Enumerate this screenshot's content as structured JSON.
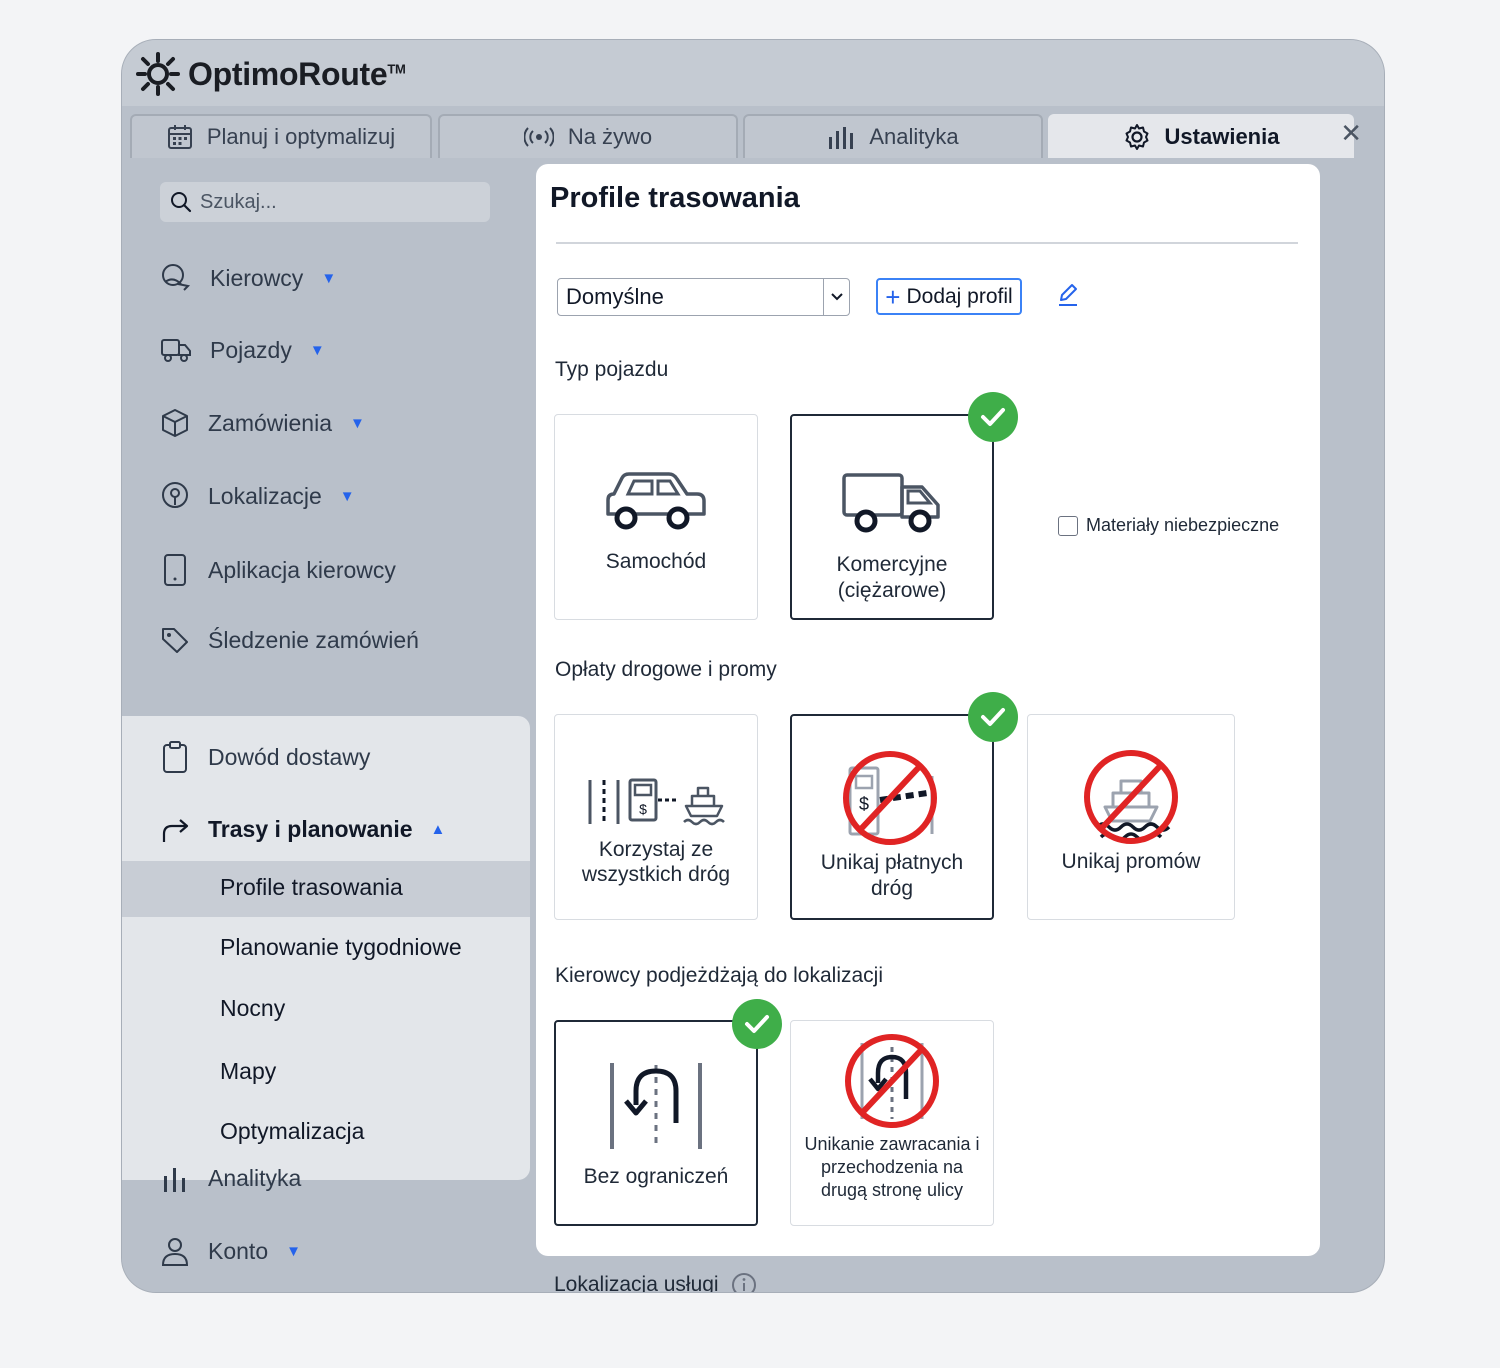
{
  "app": {
    "logo_text": "OptimoRoute",
    "logo_tm": "TM"
  },
  "tabs": [
    {
      "label": "Planuj i optymalizuj",
      "icon": "calendar-icon"
    },
    {
      "label": "Na żywo",
      "icon": "broadcast-icon"
    },
    {
      "label": "Analityka",
      "icon": "bar-chart-icon"
    },
    {
      "label": "Ustawienia",
      "icon": "gear-icon",
      "active": true
    }
  ],
  "sidebar": {
    "search_placeholder": "Szukaj...",
    "items": [
      {
        "label": "Kierowcy",
        "icon": "drivers-icon",
        "expandable": true
      },
      {
        "label": "Pojazdy",
        "icon": "truck-icon",
        "expandable": true
      },
      {
        "label": "Zamówienia",
        "icon": "box-icon",
        "expandable": true
      },
      {
        "label": "Lokalizacje",
        "icon": "location-pin-icon",
        "expandable": true
      },
      {
        "label": "Aplikacja kierowcy",
        "icon": "phone-icon"
      },
      {
        "label": "Śledzenie zamówień",
        "icon": "tag-icon"
      }
    ],
    "proof": {
      "label": "Dowód dostawy",
      "icon": "clipboard-icon"
    },
    "routes": {
      "label": "Trasy i planowanie",
      "icon": "route-arrow-icon"
    },
    "sub_items": [
      "Profile trasowania",
      "Planowanie tygodniowe",
      "Nocny",
      "Mapy",
      "Optymalizacja"
    ],
    "active_sub": "Profile trasowania",
    "analytics": {
      "label": "Analityka",
      "icon": "bar-chart-icon"
    },
    "account": {
      "label": "Konto",
      "icon": "user-icon"
    }
  },
  "panel": {
    "title": "Profile trasowania",
    "profile_select": "Domyślne",
    "add_profile": "Dodaj profil",
    "vehicle_type": {
      "label": "Typ pojazdu",
      "options": [
        {
          "label": "Samochód",
          "selected": false
        },
        {
          "label": "Komercyjne (ciężarowe)",
          "selected": true
        }
      ],
      "hazmat_label": "Materiały niebezpieczne",
      "hazmat_checked": false
    },
    "tolls": {
      "label": "Opłaty drogowe i promy",
      "options": [
        {
          "label": "Korzystaj ze wszystkich dróg",
          "selected": false
        },
        {
          "label": "Unikaj płatnych dróg",
          "selected": true
        },
        {
          "label": "Unikaj promów",
          "selected": false
        }
      ]
    },
    "approach": {
      "label": "Kierowcy podjeżdżają do lokalizacji",
      "options": [
        {
          "label": "Bez ograniczeń",
          "selected": true
        },
        {
          "label": "Unikanie zawracania i przechodzenia na drugą stronę ulicy",
          "selected": false
        }
      ]
    },
    "service_location": "Lokalizacja usługi"
  },
  "colors": {
    "accent": "#2563eb",
    "check": "#3fae49",
    "forbidden": "#e02424"
  }
}
